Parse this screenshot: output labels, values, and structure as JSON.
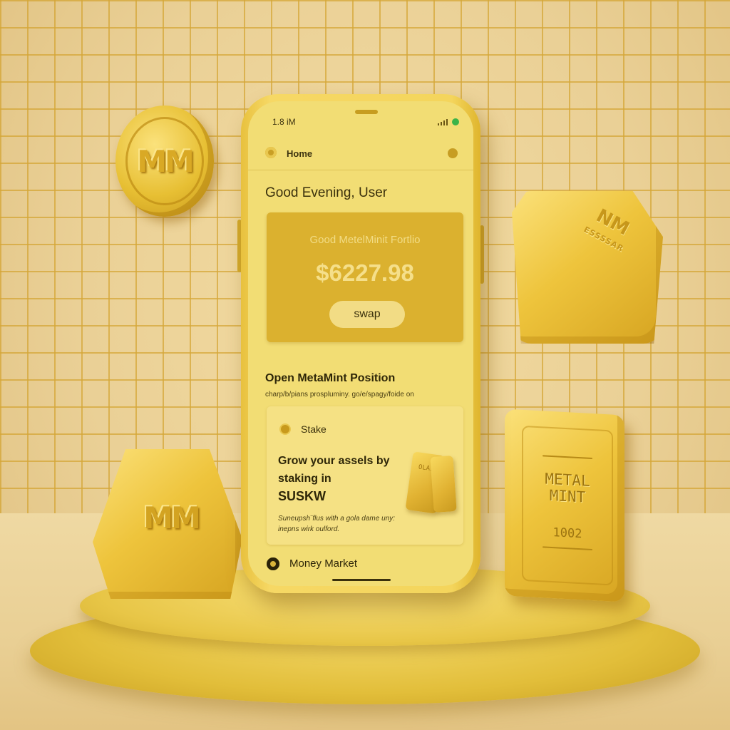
{
  "status_bar": {
    "time": "1.8 iM"
  },
  "nav": {
    "home_label": "Home"
  },
  "greeting": "Good Evening, User",
  "portfolio": {
    "title": "Good MetelMinit Fortlio",
    "value": "$6227.98",
    "swap_label": "swap"
  },
  "position": {
    "heading": "Open MetaMint Position",
    "subtitle": "charp/b/pians prospluminy. go/e/spagy/foide on"
  },
  "stake": {
    "label": "Stake",
    "heading_line1": "Grow your assels by",
    "heading_line2": "staking in",
    "heading_line3": "SUSKW",
    "description": "Suneupsh¨flus with a gola dame uny: inepns wirk oulford.",
    "mini_bar_text": "OLAI"
  },
  "bottom_nav": {
    "money_market_label": "Money Market"
  },
  "scene": {
    "coin_text": "MM",
    "cube_mark": "NM",
    "cube_sub": "ESSSSAR",
    "left_block_mark": "MM",
    "bar_title": "METAL MINT",
    "bar_number": "1002"
  },
  "colors": {
    "gold_accent": "#dbb12f",
    "screen_bg": "#f2dd74",
    "status_green": "#3bb348"
  },
  "icons": {
    "home": "home-icon",
    "profile": "profile-icon",
    "stake": "stake-icon",
    "money_market": "money-market-icon"
  }
}
